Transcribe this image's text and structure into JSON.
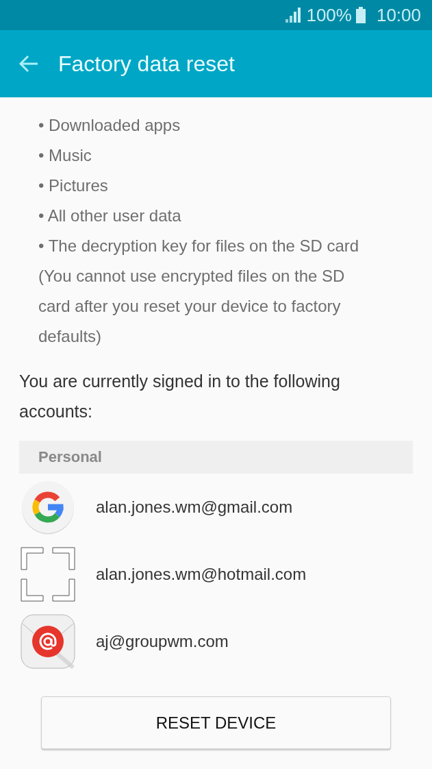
{
  "status_bar": {
    "battery_percent": "100%",
    "time": "10:00"
  },
  "app_bar": {
    "title": "Factory data reset"
  },
  "erased_items": [
    "• Downloaded apps",
    "• Music",
    "• Pictures",
    "• All other user data",
    "• The decryption key for files on the SD card"
  ],
  "note": "(You cannot use encrypted files on the SD card after you reset your device to factory defaults)",
  "accounts_intro": "You are currently signed in to the following accounts:",
  "account_groups": [
    {
      "header": "Personal",
      "accounts": [
        {
          "kind": "google",
          "email": "alan.jones.wm@gmail.com"
        },
        {
          "kind": "generic",
          "email": "alan.jones.wm@hotmail.com"
        },
        {
          "kind": "email",
          "email": "aj@groupwm.com"
        }
      ]
    }
  ],
  "reset_button": "RESET DEVICE"
}
